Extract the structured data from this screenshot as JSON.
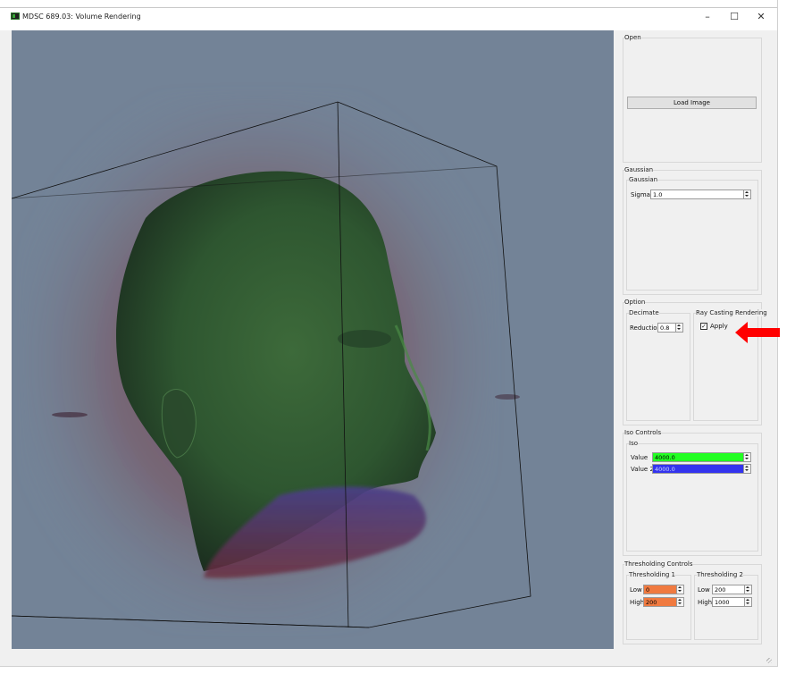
{
  "window": {
    "title": "MDSC 689.03: Volume Rendering",
    "controls": {
      "minimize": "–",
      "maximize": "☐",
      "close": "✕"
    }
  },
  "panel": {
    "open": {
      "title": "Open",
      "load_button": "Load Image"
    },
    "gaussian": {
      "title": "Gaussian",
      "inner_title": "Gaussian",
      "sigma_label": "Sigma",
      "sigma_value": "1.0"
    },
    "option": {
      "title": "Option",
      "decimate": {
        "title": "Decimate",
        "reduction_label": "Reduction",
        "reduction_value": "0.8"
      },
      "ray_casting": {
        "title": "Ray Casting Rendering",
        "apply_label": "Apply",
        "apply_checked": true,
        "check_glyph": "✓"
      }
    },
    "iso": {
      "title": "Iso Controls",
      "inner_title": "Iso",
      "value_label": "Value",
      "value": "4000.0",
      "value_color": "#22ff22",
      "value2_label": "Value 2",
      "value2": "4000.0",
      "value2_color": "#3333ee"
    },
    "thresholding": {
      "title": "Thresholding Controls",
      "t1": {
        "title": "Thresholding 1",
        "low_label": "Low",
        "low_value": "0",
        "high_label": "High",
        "high_value": "200",
        "color": "#f07a40"
      },
      "t2": {
        "title": "Thresholding 2",
        "low_label": "Low",
        "low_value": "200",
        "high_label": "High",
        "high_value": "1000"
      }
    }
  },
  "icons": {
    "app": "app-icon",
    "annotation": "red-arrow-icon"
  },
  "colors": {
    "viewport_bg": "#738397",
    "annotation_arrow": "#ff0000"
  }
}
